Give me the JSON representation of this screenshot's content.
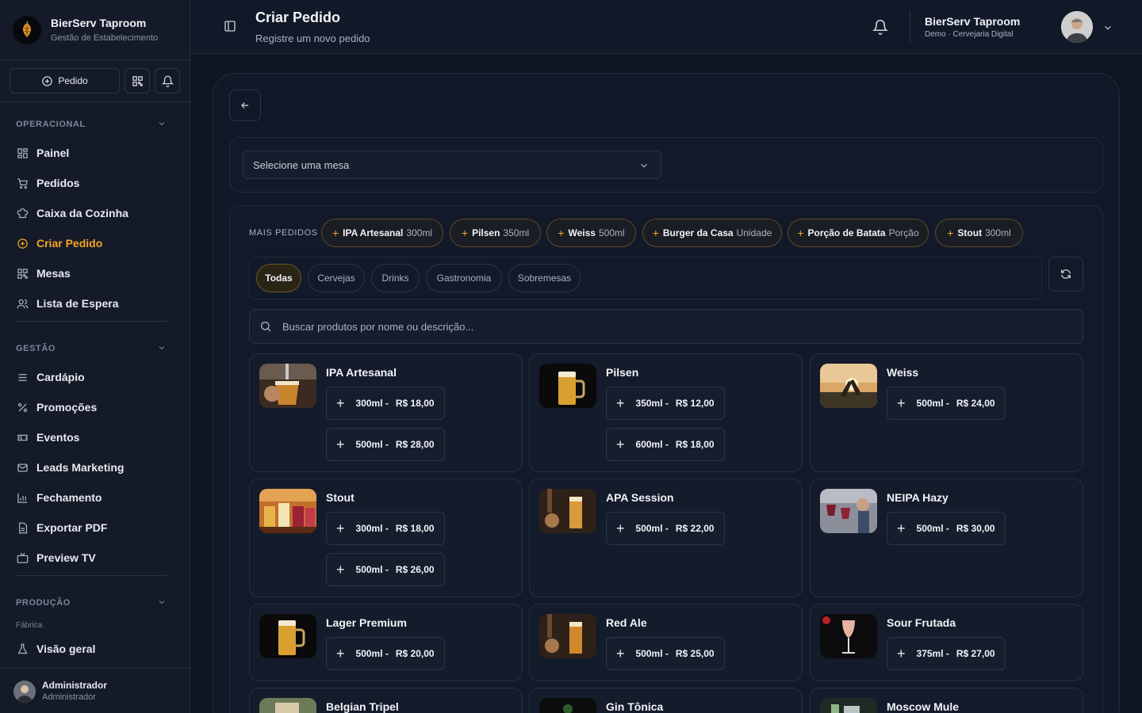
{
  "brand": {
    "name": "BierServ Taproom",
    "subtitle": "Gestão de Estabelecimento"
  },
  "quick_actions": {
    "new_order": "Pedido"
  },
  "sidebar": {
    "sections": [
      {
        "title": "OPERACIONAL",
        "items": [
          "Painel",
          "Pedidos",
          "Caixa da Cozinha",
          "Criar Pedido",
          "Mesas",
          "Lista de Espera"
        ]
      },
      {
        "title": "GESTÃO",
        "items": [
          "Cardápio",
          "Promoções",
          "Eventos",
          "Leads Marketing",
          "Fechamento",
          "Exportar PDF",
          "Preview TV"
        ]
      },
      {
        "title": "PRODUÇÃO",
        "sublabel": "Fábrica",
        "items": [
          "Visão geral"
        ]
      }
    ],
    "active_item": "Criar Pedido"
  },
  "user": {
    "name": "Administrador",
    "role": "Administrador"
  },
  "header": {
    "title": "Criar Pedido",
    "subtitle": "Registre um novo pedido",
    "org_name": "BierServ Taproom",
    "org_sub": "Demo · Cervejaria Digital"
  },
  "table_select": {
    "placeholder": "Selecione uma mesa"
  },
  "most_ordered": {
    "label": "MAIS PEDIDOS",
    "items": [
      {
        "name": "IPA Artesanal",
        "size": "300ml"
      },
      {
        "name": "Pilsen",
        "size": "350ml"
      },
      {
        "name": "Weiss",
        "size": "500ml"
      },
      {
        "name": "Burger da Casa",
        "size": "Unidade"
      },
      {
        "name": "Porção de Batata",
        "size": "Porção"
      },
      {
        "name": "Stout",
        "size": "300ml"
      }
    ]
  },
  "categories": {
    "items": [
      "Todas",
      "Cervejas",
      "Drinks",
      "Gastronomia",
      "Sobremesas"
    ],
    "active": "Todas"
  },
  "search": {
    "placeholder": "Buscar produtos por nome ou descrição..."
  },
  "products": [
    {
      "name": "IPA Artesanal",
      "variants": [
        {
          "size": "300ml -",
          "price": "R$ 18,00"
        },
        {
          "size": "500ml -",
          "price": "R$ 28,00"
        }
      ]
    },
    {
      "name": "Pilsen",
      "variants": [
        {
          "size": "350ml -",
          "price": "R$ 12,00"
        },
        {
          "size": "600ml -",
          "price": "R$ 18,00"
        }
      ]
    },
    {
      "name": "Weiss",
      "variants": [
        {
          "size": "500ml -",
          "price": "R$ 24,00"
        }
      ]
    },
    {
      "name": "Stout",
      "variants": [
        {
          "size": "300ml -",
          "price": "R$ 18,00"
        },
        {
          "size": "500ml -",
          "price": "R$ 26,00"
        }
      ]
    },
    {
      "name": "APA Session",
      "variants": [
        {
          "size": "500ml -",
          "price": "R$ 22,00"
        }
      ]
    },
    {
      "name": "NEIPA Hazy",
      "variants": [
        {
          "size": "500ml -",
          "price": "R$ 30,00"
        }
      ]
    },
    {
      "name": "Lager Premium",
      "variants": [
        {
          "size": "500ml -",
          "price": "R$ 20,00"
        }
      ]
    },
    {
      "name": "Red Ale",
      "variants": [
        {
          "size": "500ml -",
          "price": "R$ 25,00"
        }
      ]
    },
    {
      "name": "Sour Frutada",
      "variants": [
        {
          "size": "375ml -",
          "price": "R$ 27,00"
        }
      ]
    },
    {
      "name": "Belgian Tripel",
      "variants": []
    },
    {
      "name": "Gin Tônica",
      "variants": []
    },
    {
      "name": "Moscow Mule",
      "variants": []
    }
  ],
  "colors": {
    "accent": "#f5a623",
    "background": "#0f1521",
    "sidebar": "#141a27",
    "card": "#141b2a"
  }
}
